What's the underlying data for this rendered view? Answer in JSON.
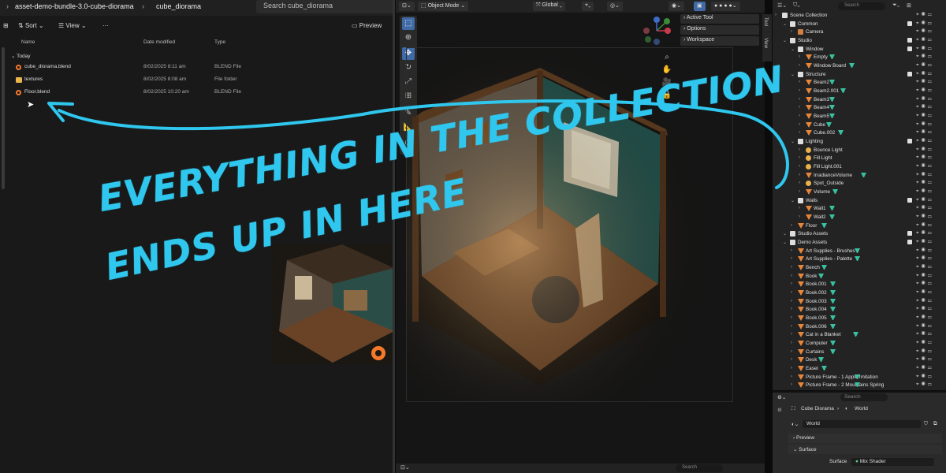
{
  "explorer": {
    "breadcrumbs": [
      "asset-demo-bundle-3.0-cube-diorama",
      "cube_diorama"
    ],
    "search_placeholder": "Search cube_diorama",
    "toolbar": {
      "sort": "Sort",
      "view": "View",
      "more": "···",
      "preview": "Preview"
    },
    "columns": {
      "name": "Name",
      "date": "Date modified",
      "type": "Type"
    },
    "group": "Today",
    "files": [
      {
        "name": "cube_diorama.blend",
        "date": "8/02/2025 8:11 am",
        "type": "BLEND File",
        "icon": "blend-file-icon"
      },
      {
        "name": "textures",
        "date": "8/02/2025 8:08 am",
        "type": "File folder",
        "icon": "folder-icon"
      },
      {
        "name": "Floor.blend",
        "date": "8/02/2025 10:20 am",
        "type": "BLEND File",
        "icon": "blend-file-icon"
      }
    ]
  },
  "viewport": {
    "mode": "Object Mode",
    "transform": "Global",
    "npanel": [
      "Active Tool",
      "Options",
      "Workspace"
    ],
    "side_tabs": [
      "Tool",
      "View"
    ],
    "footer_search": "Search"
  },
  "outliner": {
    "search_placeholder": "Search",
    "rows": [
      {
        "label": "Scene Collection",
        "indent": 0,
        "icon": "scene-icon"
      },
      {
        "label": "Common",
        "indent": 1,
        "icon": "collection-icon",
        "check": true
      },
      {
        "label": "Camera",
        "indent": 2,
        "icon": "camera-icon"
      },
      {
        "label": "Studio",
        "indent": 1,
        "icon": "collection-icon",
        "check": true
      },
      {
        "label": "Window",
        "indent": 2,
        "icon": "collection-icon",
        "check": true
      },
      {
        "label": "Empty",
        "indent": 3,
        "icon": "object-icon"
      },
      {
        "label": "Window Board",
        "indent": 3,
        "icon": "object-icon"
      },
      {
        "label": "Structure",
        "indent": 2,
        "icon": "collection-icon",
        "check": true
      },
      {
        "label": "Beam2",
        "indent": 3,
        "icon": "object-icon"
      },
      {
        "label": "Beam2.001",
        "indent": 3,
        "icon": "object-icon"
      },
      {
        "label": "Beam3",
        "indent": 3,
        "icon": "object-icon"
      },
      {
        "label": "Beam4",
        "indent": 3,
        "icon": "object-icon"
      },
      {
        "label": "Beam5",
        "indent": 3,
        "icon": "object-icon"
      },
      {
        "label": "Cube",
        "indent": 3,
        "icon": "object-icon"
      },
      {
        "label": "Cube.002",
        "indent": 3,
        "icon": "object-icon"
      },
      {
        "label": "Lighting",
        "indent": 2,
        "icon": "collection-icon",
        "check": true
      },
      {
        "label": "Bounce Light",
        "indent": 3,
        "icon": "light-icon"
      },
      {
        "label": "Fill Light",
        "indent": 3,
        "icon": "light-icon"
      },
      {
        "label": "Fill Light.001",
        "indent": 3,
        "icon": "light-icon"
      },
      {
        "label": "IrradianceVolume",
        "indent": 3,
        "icon": "object-icon"
      },
      {
        "label": "Spot_Outside",
        "indent": 3,
        "icon": "light-icon"
      },
      {
        "label": "Volume",
        "indent": 3,
        "icon": "object-icon"
      },
      {
        "label": "Walls",
        "indent": 2,
        "icon": "collection-icon",
        "check": true
      },
      {
        "label": "Wall1",
        "indent": 3,
        "icon": "object-icon"
      },
      {
        "label": "Wall2",
        "indent": 3,
        "icon": "object-icon"
      },
      {
        "label": "Floor",
        "indent": 2,
        "icon": "object-icon"
      },
      {
        "label": "Studio Assets",
        "indent": 1,
        "icon": "collection-icon",
        "check": true
      },
      {
        "label": "Demo Assets",
        "indent": 1,
        "icon": "collection-icon",
        "check": true
      },
      {
        "label": "Art Supplies - Brushes",
        "indent": 2,
        "icon": "object-icon"
      },
      {
        "label": "Art Supplies - Palette",
        "indent": 2,
        "icon": "object-icon"
      },
      {
        "label": "Bench",
        "indent": 2,
        "icon": "object-icon"
      },
      {
        "label": "Book",
        "indent": 2,
        "icon": "object-icon"
      },
      {
        "label": "Book.001",
        "indent": 2,
        "icon": "object-icon"
      },
      {
        "label": "Book.002",
        "indent": 2,
        "icon": "object-icon"
      },
      {
        "label": "Book.003",
        "indent": 2,
        "icon": "object-icon"
      },
      {
        "label": "Book.004",
        "indent": 2,
        "icon": "object-icon"
      },
      {
        "label": "Book.005",
        "indent": 2,
        "icon": "object-icon"
      },
      {
        "label": "Book.006",
        "indent": 2,
        "icon": "object-icon"
      },
      {
        "label": "Cat in a Blanket",
        "indent": 2,
        "icon": "object-icon"
      },
      {
        "label": "Computer",
        "indent": 2,
        "icon": "object-icon"
      },
      {
        "label": "Curtains",
        "indent": 2,
        "icon": "object-icon"
      },
      {
        "label": "Desk",
        "indent": 2,
        "icon": "object-icon"
      },
      {
        "label": "Easel",
        "indent": 2,
        "icon": "object-icon"
      },
      {
        "label": "Picture Frame - 1 Apple Imitation",
        "indent": 2,
        "icon": "object-icon"
      },
      {
        "label": "Picture Frame - 2 Mountains Spring",
        "indent": 2,
        "icon": "object-icon"
      }
    ]
  },
  "properties": {
    "search_placeholder": "Search",
    "breadcrumb_scene": "Cube Diorama",
    "breadcrumb_world": "World",
    "world_field": "World",
    "panels": [
      "Preview",
      "Surface"
    ],
    "surface_label": "Surface",
    "surface_value": "Mix Shader"
  },
  "annotation": {
    "line1": "EVERYTHING IN THE COLLECTION",
    "line2": "ENDS UP IN HERE"
  },
  "colors": {
    "accent": "#2fc7ee",
    "blender_orange": "#f5792a",
    "folder": "#e8b64d"
  }
}
